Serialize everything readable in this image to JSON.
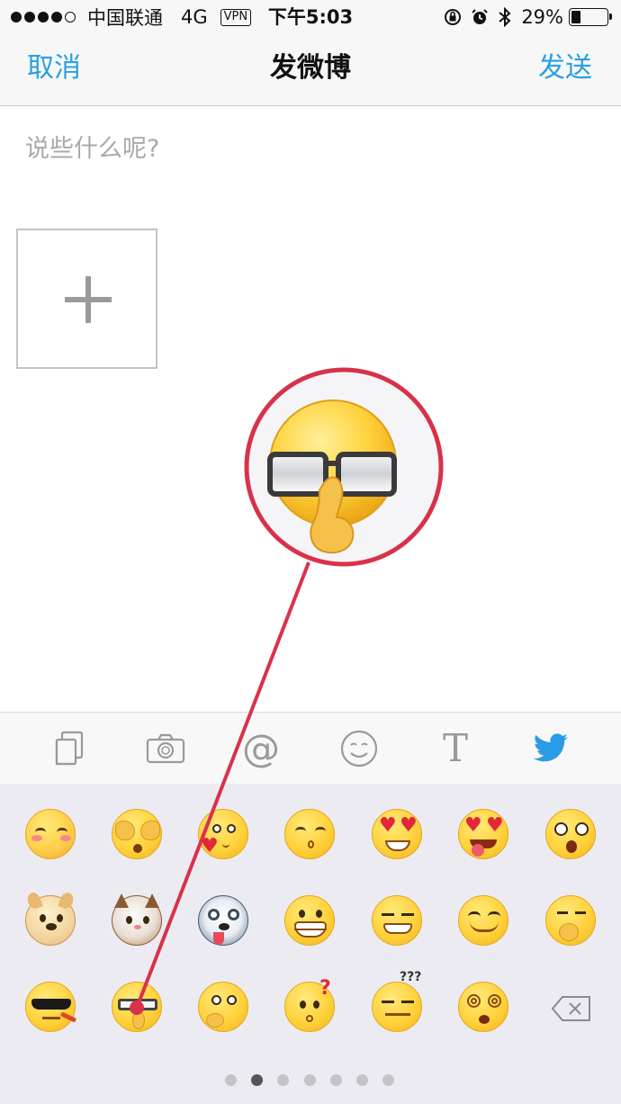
{
  "status_bar": {
    "signal": "●●●●○",
    "carrier": "中国联通",
    "network": "4G",
    "vpn": "VPN",
    "time": "下午5:03",
    "battery_percent": "29%",
    "battery_level": 0.29
  },
  "nav": {
    "cancel_label": "取消",
    "title": "发微博",
    "send_label": "发送"
  },
  "compose": {
    "placeholder": "说些什么呢?",
    "value": ""
  },
  "add_photo": {
    "icon": "plus-icon"
  },
  "toolbar": {
    "items": [
      {
        "icon": "copy-icon"
      },
      {
        "icon": "camera-icon"
      },
      {
        "icon": "at-icon",
        "glyph": "@"
      },
      {
        "icon": "smiley-icon"
      },
      {
        "icon": "text-icon",
        "glyph": "T"
      },
      {
        "icon": "bird-icon"
      }
    ]
  },
  "emoji_keyboard": {
    "rows": [
      [
        "blush-emoji",
        "cover-eyes-emoji",
        "heart-love-emoji",
        "kiss-emoji",
        "heart-eyes-emoji",
        "tongue-heart-emoji",
        "surprised-emoji"
      ],
      [
        "doge-emoji",
        "cat-emoji",
        "husky-emoji",
        "grin-emoji",
        "smirk-emoji",
        "content-emoji",
        "think-emoji"
      ],
      [
        "cool-shades-emoji",
        "glasses-emoji",
        "ponder-emoji",
        "question-emoji",
        "confused-emoji",
        "dizzy-emoji",
        "backspace-icon"
      ]
    ],
    "page_count": 7,
    "current_page": 2,
    "accent": "#d8324a"
  },
  "colors": {
    "link_blue": "#2aa0e0",
    "bird_blue": "#2a9be6",
    "annotation_red": "#d8324a"
  }
}
